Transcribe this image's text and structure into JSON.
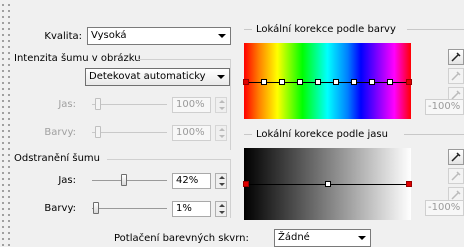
{
  "quality": {
    "label": "Kvalita:",
    "value": "Vysoká"
  },
  "noise_intensity": {
    "title": "Intenzita šumu v obrázku",
    "mode": "Detekovat automaticky",
    "luma_label": "Jas:",
    "luma_value": "100%",
    "luma_level": 1.0,
    "chroma_label": "Barvy:",
    "chroma_value": "100%",
    "chroma_level": 1.0
  },
  "noise_removal": {
    "title": "Odstranění šumu",
    "luma_label": "Jas:",
    "luma_value": "42%",
    "luma_level": 0.42,
    "chroma_label": "Barvy:",
    "chroma_value": "1%",
    "chroma_level": 0.01
  },
  "color_spot": {
    "label": "Potlačení barevných skvrn:",
    "value": "Žádné"
  },
  "color_correction": {
    "title": "Lokální korekce podle barvy",
    "side_value": "-100%"
  },
  "luma_correction": {
    "title": "Lokální korekce podle jasu",
    "side_value": "-100%"
  },
  "icons": [
    "pipette-icon",
    "pipette-disabled-icon"
  ],
  "colors": {
    "curve_endpoint": "#e00000"
  }
}
